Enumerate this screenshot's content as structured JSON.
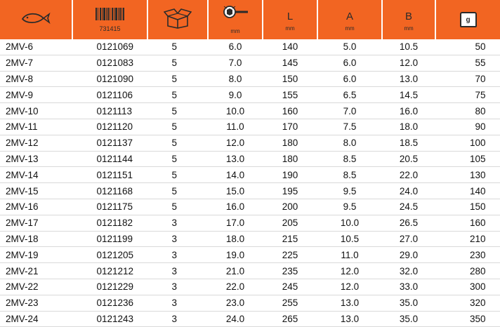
{
  "header": {
    "product_icon": "fish-icon",
    "barcode_icon": "barcode-icon",
    "barcode_code": "731415",
    "package_icon": "open-box-icon",
    "size_icon": "wrench-size-icon",
    "size_unit": "mm",
    "col_L": "L",
    "col_L_unit": "mm",
    "col_A": "A",
    "col_A_unit": "mm",
    "col_B": "B",
    "col_B_unit": "mm",
    "weight_icon": "weight-icon",
    "weight_label": "g",
    "accent_color": "#f26522"
  },
  "rows": [
    {
      "model": "2MV-6",
      "code": "0121069",
      "pack": "5",
      "size": "6.0",
      "L": "140",
      "A": "5.0",
      "B": "10.5",
      "weight": "50"
    },
    {
      "model": "2MV-7",
      "code": "0121083",
      "pack": "5",
      "size": "7.0",
      "L": "145",
      "A": "6.0",
      "B": "12.0",
      "weight": "55"
    },
    {
      "model": "2MV-8",
      "code": "0121090",
      "pack": "5",
      "size": "8.0",
      "L": "150",
      "A": "6.0",
      "B": "13.0",
      "weight": "70"
    },
    {
      "model": "2MV-9",
      "code": "0121106",
      "pack": "5",
      "size": "9.0",
      "L": "155",
      "A": "6.5",
      "B": "14.5",
      "weight": "75"
    },
    {
      "model": "2MV-10",
      "code": "0121113",
      "pack": "5",
      "size": "10.0",
      "L": "160",
      "A": "7.0",
      "B": "16.0",
      "weight": "80"
    },
    {
      "model": "2MV-11",
      "code": "0121120",
      "pack": "5",
      "size": "11.0",
      "L": "170",
      "A": "7.5",
      "B": "18.0",
      "weight": "90"
    },
    {
      "model": "2MV-12",
      "code": "0121137",
      "pack": "5",
      "size": "12.0",
      "L": "180",
      "A": "8.0",
      "B": "18.5",
      "weight": "100"
    },
    {
      "model": "2MV-13",
      "code": "0121144",
      "pack": "5",
      "size": "13.0",
      "L": "180",
      "A": "8.5",
      "B": "20.5",
      "weight": "105"
    },
    {
      "model": "2MV-14",
      "code": "0121151",
      "pack": "5",
      "size": "14.0",
      "L": "190",
      "A": "8.5",
      "B": "22.0",
      "weight": "130"
    },
    {
      "model": "2MV-15",
      "code": "0121168",
      "pack": "5",
      "size": "15.0",
      "L": "195",
      "A": "9.5",
      "B": "24.0",
      "weight": "140"
    },
    {
      "model": "2MV-16",
      "code": "0121175",
      "pack": "5",
      "size": "16.0",
      "L": "200",
      "A": "9.5",
      "B": "24.5",
      "weight": "150"
    },
    {
      "model": "2MV-17",
      "code": "0121182",
      "pack": "3",
      "size": "17.0",
      "L": "205",
      "A": "10.0",
      "B": "26.5",
      "weight": "160"
    },
    {
      "model": "2MV-18",
      "code": "0121199",
      "pack": "3",
      "size": "18.0",
      "L": "215",
      "A": "10.5",
      "B": "27.0",
      "weight": "210"
    },
    {
      "model": "2MV-19",
      "code": "0121205",
      "pack": "3",
      "size": "19.0",
      "L": "225",
      "A": "11.0",
      "B": "29.0",
      "weight": "230"
    },
    {
      "model": "2MV-21",
      "code": "0121212",
      "pack": "3",
      "size": "21.0",
      "L": "235",
      "A": "12.0",
      "B": "32.0",
      "weight": "280"
    },
    {
      "model": "2MV-22",
      "code": "0121229",
      "pack": "3",
      "size": "22.0",
      "L": "245",
      "A": "12.0",
      "B": "33.0",
      "weight": "300"
    },
    {
      "model": "2MV-23",
      "code": "0121236",
      "pack": "3",
      "size": "23.0",
      "L": "255",
      "A": "13.0",
      "B": "35.0",
      "weight": "320"
    },
    {
      "model": "2MV-24",
      "code": "0121243",
      "pack": "3",
      "size": "24.0",
      "L": "265",
      "A": "13.0",
      "B": "35.0",
      "weight": "350"
    }
  ]
}
